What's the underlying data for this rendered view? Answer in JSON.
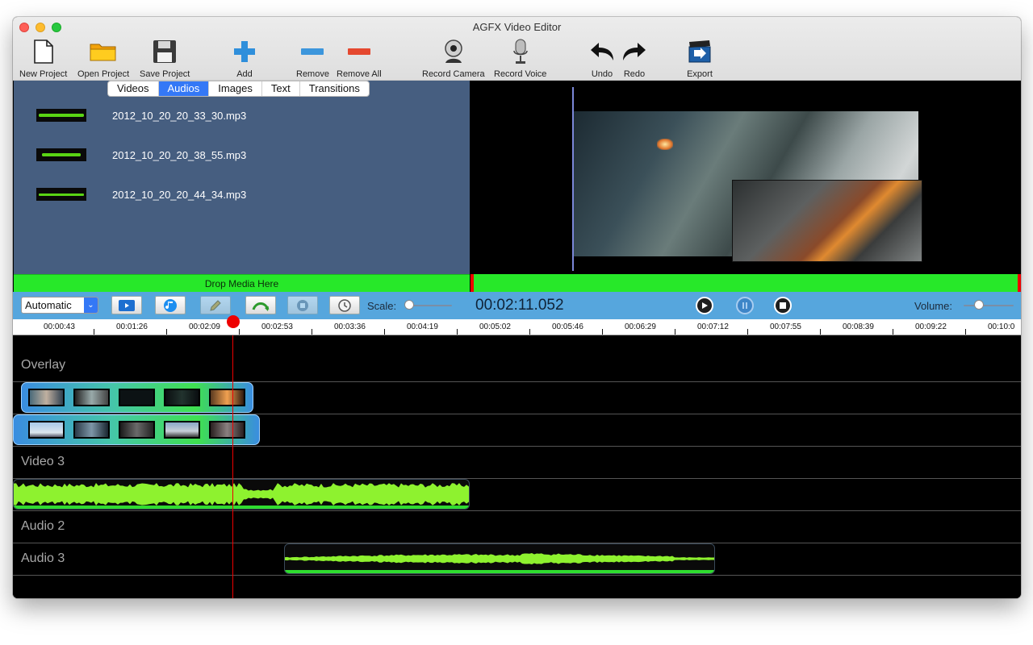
{
  "window": {
    "title": "AGFX Video Editor"
  },
  "toolbar": {
    "new_project": "New Project",
    "open_project": "Open Project",
    "save_project": "Save Project",
    "add": "Add",
    "remove": "Remove",
    "remove_all": "Remove All",
    "record_camera": "Record Camera",
    "record_voice": "Record Voice",
    "undo": "Undo",
    "redo": "Redo",
    "export": "Export"
  },
  "media": {
    "tabs": [
      "Videos",
      "Audios",
      "Images",
      "Text",
      "Transitions"
    ],
    "active_tab": "Audios",
    "items": [
      "2012_10_20_20_33_30.mp3",
      "2012_10_20_20_38_55.mp3",
      "2012_10_20_20_44_34.mp3"
    ],
    "drop_label": "Drop Media Here"
  },
  "controls": {
    "mode": "Automatic",
    "scale_label": "Scale:",
    "timecode": "00:02:11.052",
    "volume_label": "Volume:",
    "scale_level": 0.05,
    "volume_level": 0.3
  },
  "ruler": {
    "ticks": [
      "00:00:43",
      "00:01:26",
      "00:02:09",
      "00:02:53",
      "00:03:36",
      "00:04:19",
      "00:05:02",
      "00:05:46",
      "00:06:29",
      "00:07:12",
      "00:07:55",
      "00:08:39",
      "00:09:22",
      "00:10:0"
    ]
  },
  "tracks": {
    "overlay": "Overlay",
    "video3": "Video 3",
    "audio2": "Audio 2",
    "audio3": "Audio 3"
  },
  "colors": {
    "accent": "#3478f6",
    "drop_green": "#27e829",
    "controls_blue": "#56a6dd",
    "waveform": "#8ef22f",
    "playhead": "#e00000"
  }
}
